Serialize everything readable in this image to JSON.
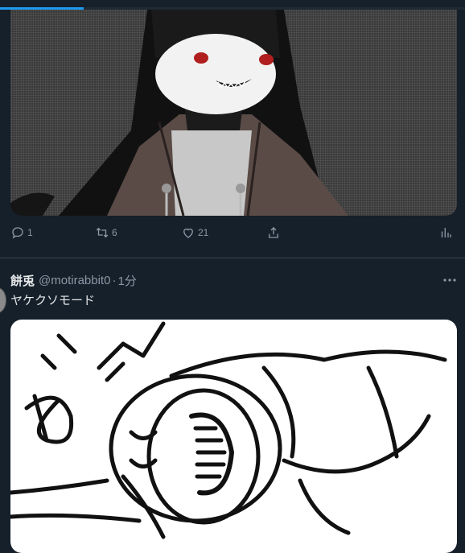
{
  "load_progress": 0.18,
  "tweet1": {
    "media_alt": "drawing of a dark-haired character with red eyes and a sharp-toothed grin wearing a hoodie",
    "reply_count": "1",
    "retweet_count": "6",
    "like_count": "21"
  },
  "tweet2": {
    "display_name": "餅兎",
    "handle": "@motirabbit0",
    "separator": "·",
    "time": "1分",
    "text": "ヤケクソモード",
    "media_alt": "black line sketch on white of a character face down with mouth wide open"
  },
  "icons": [
    "reply-icon",
    "retweet-icon",
    "like-icon",
    "share-icon",
    "analytics-icon",
    "more-icon"
  ],
  "colors": {
    "background": "#15202b",
    "accent": "#1d9bf0",
    "muted": "#8b98a5"
  }
}
